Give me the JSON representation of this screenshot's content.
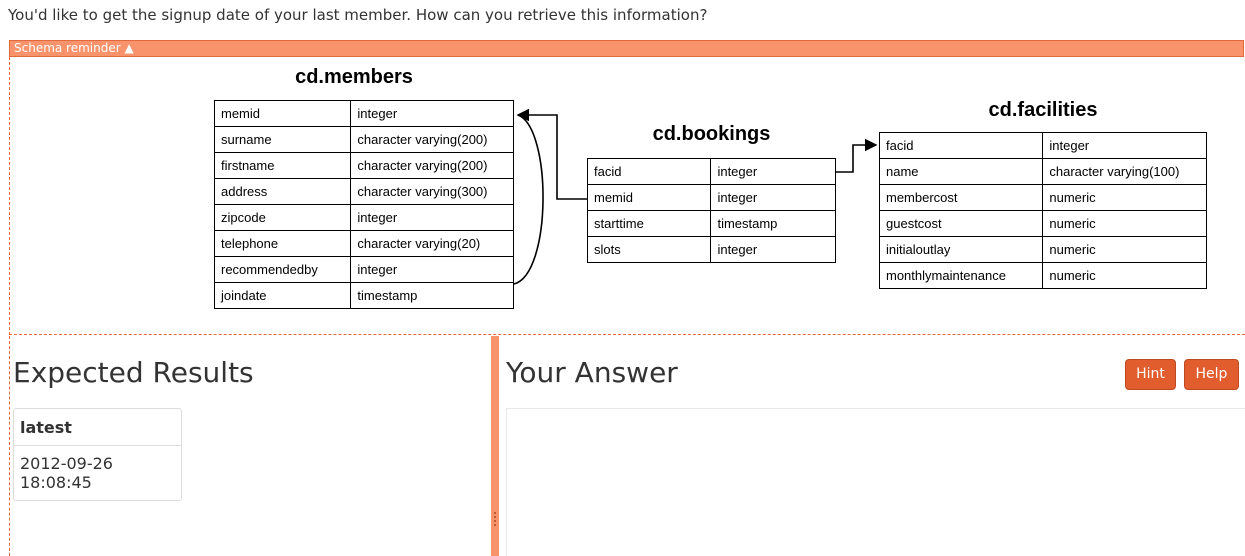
{
  "question": "You'd like to get the signup date of your last member. How can you retrieve this information?",
  "schema_reminder": {
    "label": "Schema reminder",
    "arrow": "▲",
    "tables": {
      "members": {
        "title": "cd.members",
        "rows": [
          {
            "name": "memid",
            "type": "integer"
          },
          {
            "name": "surname",
            "type": "character varying(200)"
          },
          {
            "name": "firstname",
            "type": "character varying(200)"
          },
          {
            "name": "address",
            "type": "character varying(300)"
          },
          {
            "name": "zipcode",
            "type": "integer"
          },
          {
            "name": "telephone",
            "type": "character varying(20)"
          },
          {
            "name": "recommendedby",
            "type": "integer"
          },
          {
            "name": "joindate",
            "type": "timestamp"
          }
        ]
      },
      "bookings": {
        "title": "cd.bookings",
        "rows": [
          {
            "name": "facid",
            "type": "integer"
          },
          {
            "name": "memid",
            "type": "integer"
          },
          {
            "name": "starttime",
            "type": "timestamp"
          },
          {
            "name": "slots",
            "type": "integer"
          }
        ]
      },
      "facilities": {
        "title": "cd.facilities",
        "rows": [
          {
            "name": "facid",
            "type": "integer"
          },
          {
            "name": "name",
            "type": "character varying(100)"
          },
          {
            "name": "membercost",
            "type": "numeric"
          },
          {
            "name": "guestcost",
            "type": "numeric"
          },
          {
            "name": "initialoutlay",
            "type": "numeric"
          },
          {
            "name": "monthlymaintenance",
            "type": "numeric"
          }
        ]
      }
    }
  },
  "expected_results": {
    "heading": "Expected Results",
    "columns": [
      "latest"
    ],
    "rows": [
      [
        "2012-09-26 18:08:45"
      ]
    ]
  },
  "your_answer": {
    "heading": "Your Answer",
    "hint_label": "Hint",
    "help_label": "Help"
  },
  "colors": {
    "accent": "#f8936b",
    "button": "#e25d2e"
  }
}
